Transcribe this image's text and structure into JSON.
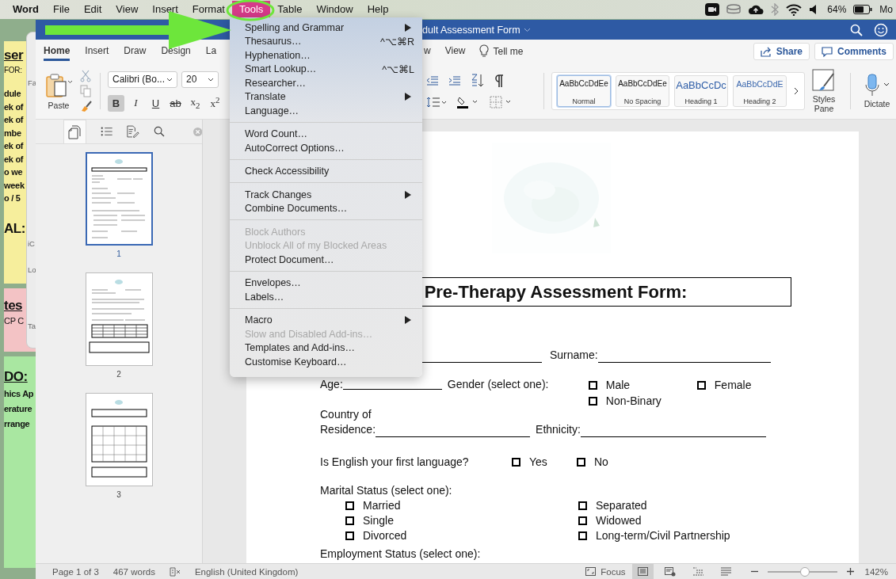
{
  "menu_bar": {
    "items": [
      {
        "label": "Word",
        "kind": "app",
        "selected": false
      },
      {
        "label": "File",
        "kind": "menu",
        "selected": false
      },
      {
        "label": "Edit",
        "kind": "menu",
        "selected": false
      },
      {
        "label": "View",
        "kind": "menu",
        "selected": false
      },
      {
        "label": "Insert",
        "kind": "menu",
        "selected": false
      },
      {
        "label": "Format",
        "kind": "menu",
        "selected": false
      },
      {
        "label": "Tools",
        "kind": "menu",
        "selected": true
      },
      {
        "label": "Table",
        "kind": "menu",
        "selected": false
      },
      {
        "label": "Window",
        "kind": "menu",
        "selected": false
      },
      {
        "label": "Help",
        "kind": "menu",
        "selected": false
      }
    ],
    "battery": "64%",
    "clock": "Mo"
  },
  "stickies": [
    {
      "color": "#f6ee9c",
      "lines": [
        {
          "text": "ser",
          "kind": "heading"
        },
        {
          "text": "FOR:",
          "kind": "small"
        },
        {
          "text": "dule",
          "kind": "bold"
        },
        {
          "text": "ek of",
          "kind": "body"
        },
        {
          "text": "ek of",
          "kind": "body"
        },
        {
          "text": "mbe",
          "kind": "body"
        },
        {
          "text": "ek of",
          "kind": "body"
        },
        {
          "text": "ek of",
          "kind": "body"
        },
        {
          "text": "o we",
          "kind": "body"
        },
        {
          "text": "week",
          "kind": "body"
        },
        {
          "text": "o / 5",
          "kind": "body"
        },
        {
          "text": "AL:",
          "kind": "heading"
        }
      ]
    },
    {
      "color": "#f3c3c5",
      "lines": [
        {
          "text": "tes",
          "kind": "heading"
        },
        {
          "text": "CP C",
          "kind": "small"
        }
      ]
    },
    {
      "color": "#a9e7a1",
      "lines": [
        {
          "text": "DO:",
          "kind": "heading"
        },
        {
          "text": "hics Ap",
          "kind": "body"
        },
        {
          "text": "erature",
          "kind": "body"
        },
        {
          "text": "rrange",
          "kind": "body"
        }
      ]
    }
  ],
  "background_window": {
    "labels": [
      "Fa",
      "iC",
      "Lo",
      "Ta"
    ]
  },
  "word": {
    "title": "dult Assessment Form",
    "tabs": [
      {
        "label": "Home",
        "selected": true
      },
      {
        "label": "Insert",
        "selected": false
      },
      {
        "label": "Draw",
        "selected": false
      },
      {
        "label": "Design",
        "selected": false
      },
      {
        "label": "La",
        "selected": false
      }
    ],
    "tabs_right": [
      {
        "label": "w",
        "selected": false
      },
      {
        "label": "View",
        "selected": false
      }
    ],
    "tell_me": "Tell me",
    "share": "Share",
    "comments": "Comments",
    "paste": "Paste",
    "font": "Calibri (Bo...",
    "font_size": "20",
    "format_buttons": [
      {
        "label": "B",
        "selected": true
      },
      {
        "label": "I",
        "selected": false
      },
      {
        "label": "U",
        "selected": false
      },
      {
        "label": "ab",
        "selected": false
      },
      {
        "label": "x$_{2}$",
        "selected": false
      },
      {
        "label": "x$^{2}$",
        "selected": false
      }
    ],
    "styles": [
      {
        "sample": "AaBbCcDdEe",
        "name": "Normal",
        "kind": "body",
        "selected": true
      },
      {
        "sample": "AaBbCcDdEe",
        "name": "No Spacing",
        "kind": "body",
        "selected": false
      },
      {
        "sample": "AaBbCcDc",
        "name": "Heading 1",
        "kind": "heading",
        "selected": false
      },
      {
        "sample": "AaBbCcDdE",
        "name": "Heading 2",
        "kind": "subheading",
        "selected": false
      }
    ],
    "styles_pane": "Styles Pane",
    "dictate": "Dictate",
    "nav_pages": [
      {
        "label": "1",
        "selected": true
      },
      {
        "label": "2",
        "selected": false
      },
      {
        "label": "3",
        "selected": false
      }
    ],
    "document": {
      "title": "Pre-Therapy Assessment Form:",
      "surname_label": "Surname:",
      "age_label": "Age:",
      "gender_label": "Gender (select one):",
      "gender_options": [
        {
          "label": "Male",
          "checked": false
        },
        {
          "label": "Female",
          "checked": false
        },
        {
          "label": "Non-Binary",
          "checked": false
        }
      ],
      "country_label": "Country of",
      "residence_label": "Residence:",
      "ethnicity_label": "Ethnicity:",
      "english_question": "Is English your first language?",
      "english_options": [
        {
          "label": "Yes",
          "checked": false
        },
        {
          "label": "No",
          "checked": false
        }
      ],
      "marital_label": "Marital Status (select one):",
      "marital_options": [
        {
          "label": "Married",
          "checked": false
        },
        {
          "label": "Separated",
          "checked": false
        },
        {
          "label": "Single",
          "checked": false
        },
        {
          "label": "Widowed",
          "checked": false
        },
        {
          "label": "Divorced",
          "checked": false
        },
        {
          "label": "Long-term/Civil Partnership",
          "checked": false
        }
      ],
      "employment_label": "Employment Status (select one):"
    },
    "status_bar": {
      "page": "Page 1 of 3",
      "words": "467 words",
      "language": "English (United Kingdom)",
      "focus": "Focus",
      "views": [
        {
          "kind": "print",
          "selected": true
        },
        {
          "kind": "web",
          "selected": false
        },
        {
          "kind": "outline",
          "selected": false
        },
        {
          "kind": "draft",
          "selected": false
        }
      ],
      "zoom": {
        "level": 0.54,
        "reading": "142%"
      }
    }
  },
  "tools_menu": {
    "groups": [
      {
        "items": [
          {
            "label": "Spelling and Grammar",
            "submenu": true,
            "disabled": false
          },
          {
            "label": "Thesaurus…",
            "shortcut": "^⌥⌘R",
            "submenu": false,
            "disabled": false
          },
          {
            "label": "Hyphenation…",
            "submenu": false,
            "disabled": false
          },
          {
            "label": "Smart Lookup…",
            "shortcut": "^⌥⌘L",
            "submenu": false,
            "disabled": false
          },
          {
            "label": "Researcher…",
            "submenu": false,
            "disabled": false
          },
          {
            "label": "Translate",
            "submenu": true,
            "disabled": false
          },
          {
            "label": "Language…",
            "submenu": false,
            "disabled": false
          }
        ]
      },
      {
        "items": [
          {
            "label": "Word Count…",
            "submenu": false,
            "disabled": false
          },
          {
            "label": "AutoCorrect Options…",
            "submenu": false,
            "disabled": false
          }
        ]
      },
      {
        "items": [
          {
            "label": "Check Accessibility",
            "submenu": false,
            "disabled": false
          }
        ]
      },
      {
        "items": [
          {
            "label": "Track Changes",
            "submenu": true,
            "disabled": false
          },
          {
            "label": "Combine Documents…",
            "submenu": false,
            "disabled": false
          }
        ]
      },
      {
        "items": [
          {
            "label": "Block Authors",
            "submenu": false,
            "disabled": true
          },
          {
            "label": "Unblock All of my Blocked Areas",
            "submenu": false,
            "disabled": true
          },
          {
            "label": "Protect Document…",
            "submenu": false,
            "disabled": false
          }
        ]
      },
      {
        "items": [
          {
            "label": "Envelopes…",
            "submenu": false,
            "disabled": false
          },
          {
            "label": "Labels…",
            "submenu": false,
            "disabled": false
          }
        ]
      },
      {
        "items": [
          {
            "label": "Macro",
            "submenu": true,
            "disabled": false
          },
          {
            "label": "Slow and Disabled Add-ins…",
            "submenu": false,
            "disabled": true
          },
          {
            "label": "Templates and Add-ins…",
            "submenu": false,
            "disabled": false
          },
          {
            "label": "Customise Keyboard…",
            "submenu": false,
            "disabled": false
          }
        ]
      }
    ]
  }
}
